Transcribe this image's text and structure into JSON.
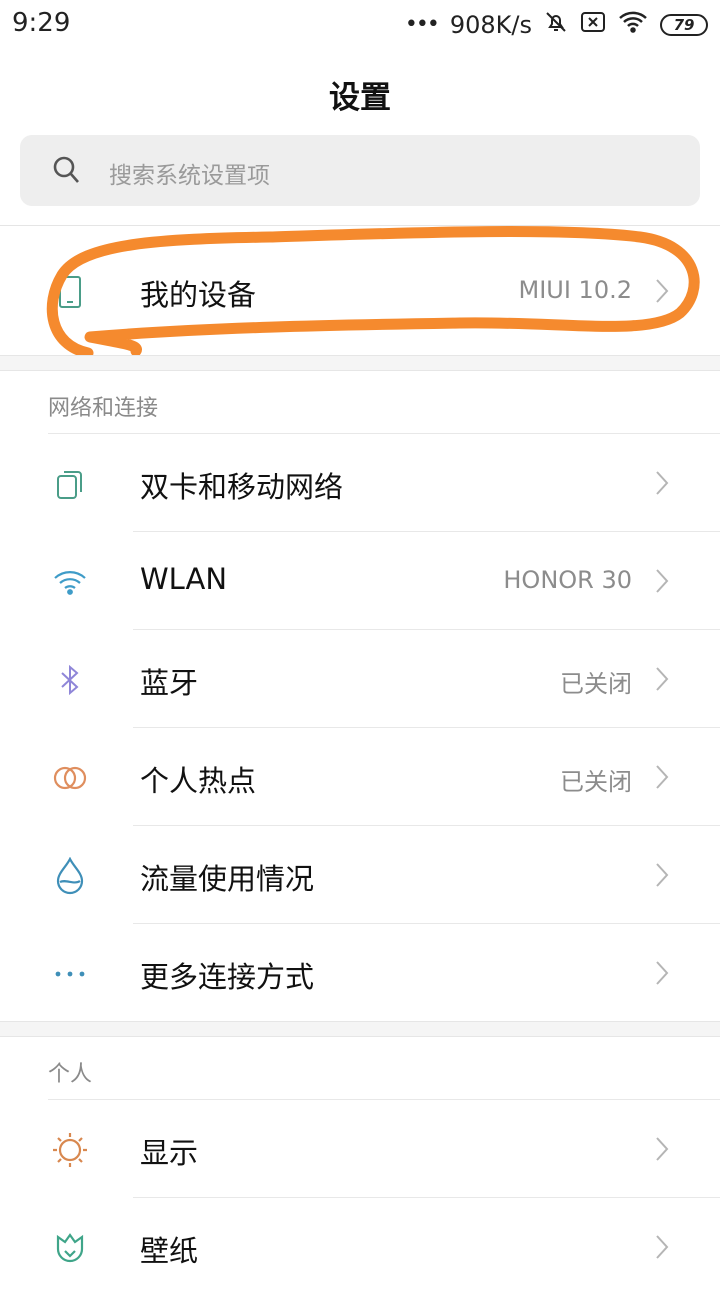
{
  "status_bar": {
    "time": "9:29",
    "dots": "•••",
    "speed": "908K/s",
    "battery": "79"
  },
  "page_title": "设置",
  "search": {
    "placeholder": "搜索系统设置项"
  },
  "device": {
    "label": "我的设备",
    "value": "MIUI 10.2"
  },
  "sections": [
    {
      "header": "网络和连接",
      "items": [
        {
          "label": "双卡和移动网络",
          "value": "",
          "icon": "sim-card-icon",
          "color": "#4a9d88"
        },
        {
          "label": "WLAN",
          "value": "HONOR 30",
          "icon": "wifi-icon",
          "color": "#3f9cc8"
        },
        {
          "label": "蓝牙",
          "value": "已关闭",
          "icon": "bluetooth-icon",
          "color": "#8f86d8"
        },
        {
          "label": "个人热点",
          "value": "已关闭",
          "icon": "hotspot-icon",
          "color": "#df8e5e"
        },
        {
          "label": "流量使用情况",
          "value": "",
          "icon": "water-drop-icon",
          "color": "#3f8fb8"
        },
        {
          "label": "更多连接方式",
          "value": "",
          "icon": "more-dots-icon",
          "color": "#3f8fb8"
        }
      ]
    },
    {
      "header": "个人",
      "items": [
        {
          "label": "显示",
          "value": "",
          "icon": "sun-icon",
          "color": "#d8884f"
        },
        {
          "label": "壁纸",
          "value": "",
          "icon": "tulip-icon",
          "color": "#3fa589"
        }
      ]
    }
  ],
  "annotation_color": "#f58a2e"
}
